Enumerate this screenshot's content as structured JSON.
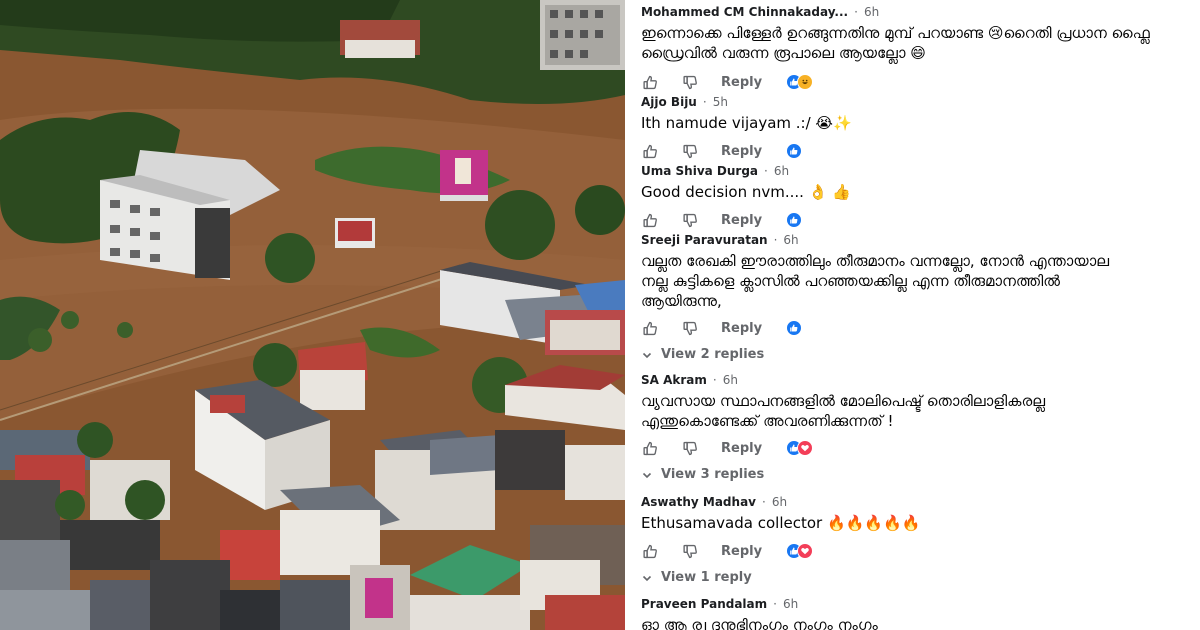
{
  "photo": {
    "billboard_1_text": "",
    "billboard_2_text": ""
  },
  "comments": [
    {
      "author": "Mohammed CM Chinnakaday...",
      "time": "6h",
      "text": "ഇന്നൊക്കെ പിള്ളേർ ഉറങ്ങുന്നതിനു മുമ്പ് പറയാണ്ട 😢റൈതി പ്രധാന ഫ്ലൈ ഡ്രൈവിൽ വരുന്ന രൂപാലെ ആയല്ലോ 😄",
      "reply_label": "Reply",
      "reactions": [
        "like",
        "haha"
      ]
    },
    {
      "author": "Ajjo Biju",
      "time": "5h",
      "text": "Ith namude vijayam .:/ 😭✨",
      "reply_label": "Reply",
      "reactions": [
        "like"
      ]
    },
    {
      "author": "Uma Shiva Durga",
      "time": "6h",
      "text": "Good decision nvm.... 👌 👍",
      "reply_label": "Reply",
      "reactions": [
        "like"
      ]
    },
    {
      "author": "Sreeji Paravuratan",
      "time": "6h",
      "text_line1": "വല്ലത രേഖകി ഈരാത്തിലും തീരുമാനം വന്നല്ലോ, നോൻ എന്തായാല",
      "text_line2": "നല്ല കുട്ടികളെ ക്ലാസിൽ പറഞ്ഞയക്കില്ല എന്ന തീരുമാനത്തിൽ",
      "text_line3": "ആയിരുന്നു,",
      "reply_label": "Reply",
      "reactions": [
        "like"
      ],
      "view_replies": "View 2 replies"
    },
    {
      "author": "SA Akram",
      "time": "6h",
      "text_line1": "വ്യവസായ സ്ഥാപനങ്ങളിൽ മോലിപെഷ്ട് തൊരിലാളികരല്ല",
      "text_line2": "എന്തുകൊണ്ടേക്ക് അവരണിക്കുന്നത് !",
      "reply_label": "Reply",
      "reactions": [
        "like",
        "love"
      ],
      "view_replies": "View 3 replies"
    },
    {
      "author": "Aswathy Madhav",
      "time": "6h",
      "text": "Ethusamavada collector 🔥🔥🔥🔥🔥",
      "reply_label": "Reply",
      "reactions": [
        "like",
        "love"
      ],
      "view_replies": "View 1 reply"
    },
    {
      "author": "Praveen Pandalam",
      "time": "6h",
      "text": "ഓ ആ ര്വ ദുനുഭിനംഗം നംഗം നംഗം"
    }
  ],
  "colors": {
    "reaction_like": "#1877f2",
    "reaction_love": "#f33e58",
    "reaction_haha": "#f7b125",
    "flood_water": "#8b5a34"
  }
}
